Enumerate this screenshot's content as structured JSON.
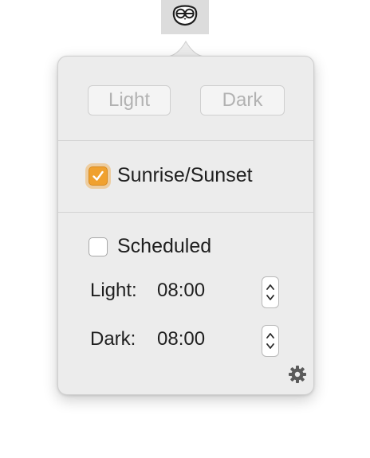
{
  "menubar": {
    "icon": "owl-icon"
  },
  "popover": {
    "mode_buttons": {
      "light_label": "Light",
      "dark_label": "Dark"
    },
    "sunrise_sunset": {
      "label": "Sunrise/Sunset",
      "checked": true
    },
    "scheduled": {
      "label": "Scheduled",
      "checked": false
    },
    "light_time": {
      "label": "Light:",
      "value": "08:00"
    },
    "dark_time": {
      "label": "Dark:",
      "value": "08:00"
    },
    "settings_icon": "gear-icon"
  },
  "colors": {
    "accent": "#f0a12f",
    "panel": "#ececec",
    "disabled_text": "#b2b2b2"
  }
}
